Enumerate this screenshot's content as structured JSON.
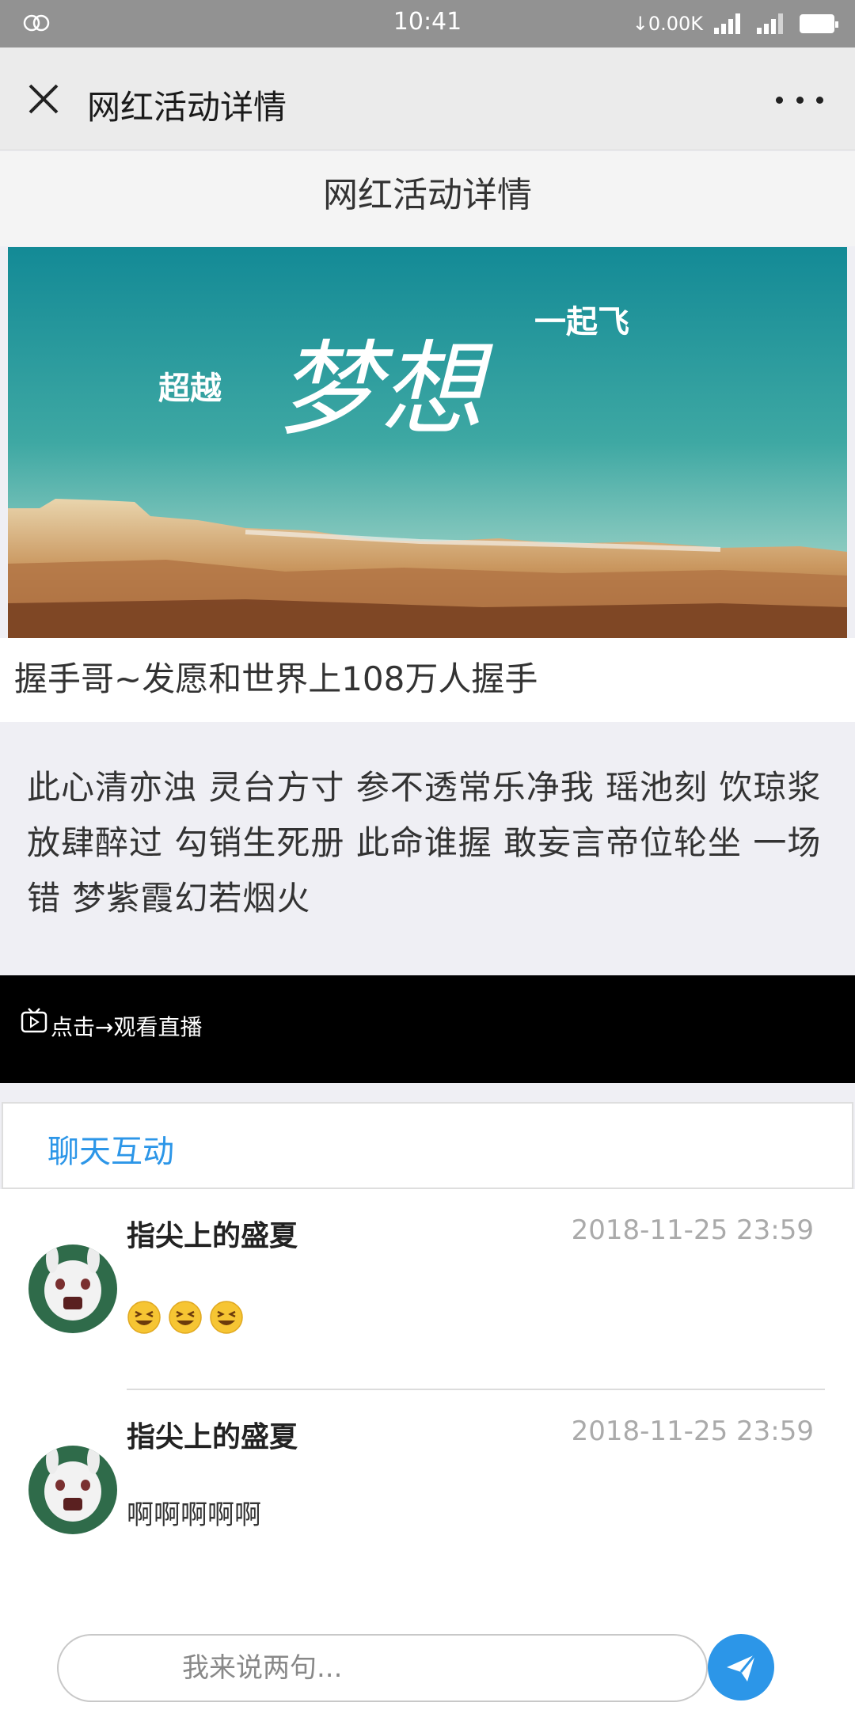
{
  "status_bar": {
    "time": "10:41",
    "net_speed": "↓0.00K",
    "network_type": "4G",
    "icons": [
      "link-icon",
      "signal-icon",
      "signal-icon",
      "battery-icon"
    ]
  },
  "nav": {
    "title": "网红活动详情",
    "close_icon": "close-icon",
    "more_icon": "more-icon"
  },
  "page": {
    "header_title": "网红活动详情",
    "banner": {
      "text_left": "超越",
      "text_main": "梦想",
      "text_right": "一起飞"
    },
    "activity_title": "握手哥~发愿和世界上108万人握手",
    "description": "此心清亦浊 灵台方寸 参不透常乐净我 瑶池刻 饮琼浆放肆醉过 勾销生死册 此命谁握 敢妄言帝位轮坐 一场错 梦紫霞幻若烟火",
    "live": {
      "icon": "tv-icon",
      "label": "点击→观看直播"
    },
    "chat_tab_label": "聊天互动"
  },
  "messages": [
    {
      "name": "指尖上的盛夏",
      "time": "2018-11-25 23:59",
      "content": "",
      "emojis": [
        "laughing-emoji",
        "laughing-emoji",
        "laughing-emoji"
      ]
    },
    {
      "name": "指尖上的盛夏",
      "time": "2018-11-25 23:59",
      "content": "啊啊啊啊啊",
      "emojis": []
    }
  ],
  "input": {
    "placeholder": "我来说两句...",
    "send_icon": "send-icon"
  },
  "colors": {
    "accent": "#2c96e8",
    "status_bar": "#929292",
    "nav_bar": "#ebebeb",
    "live_bar": "#000000"
  }
}
